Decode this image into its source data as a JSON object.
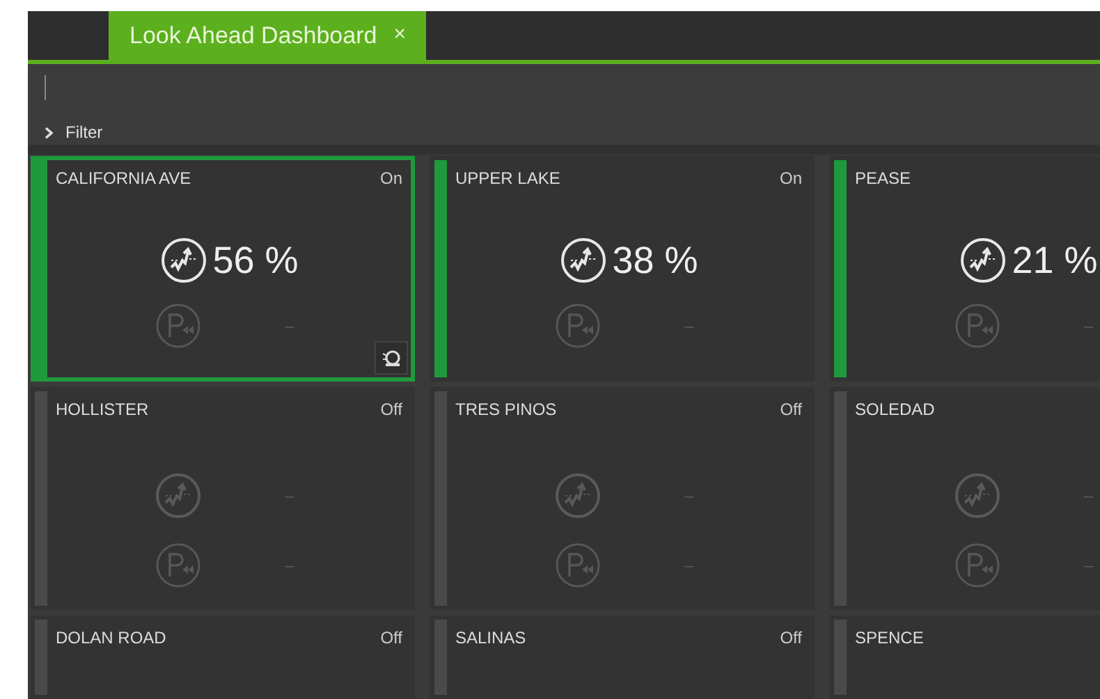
{
  "tabs": [
    {
      "label": "Look Ahead Dashboard",
      "close": "×",
      "selected": true
    }
  ],
  "filter": {
    "label": "Filter",
    "expanded": false
  },
  "cards": [
    {
      "name": "CALIFORNIA AVE",
      "status": "On",
      "on": true,
      "selected": true,
      "metrics": [
        {
          "kind": "trend",
          "value": "56 %",
          "active": true
        },
        {
          "kind": "parking",
          "value": "–",
          "active": false
        }
      ]
    },
    {
      "name": "UPPER LAKE",
      "status": "On",
      "on": true,
      "selected": false,
      "metrics": [
        {
          "kind": "trend",
          "value": "38 %",
          "active": true
        },
        {
          "kind": "parking",
          "value": "–",
          "active": false
        }
      ]
    },
    {
      "name": "PEASE",
      "on": true,
      "selected": false,
      "metrics": [
        {
          "kind": "trend",
          "value": "21 %",
          "active": true
        },
        {
          "kind": "parking",
          "value": "–",
          "active": false
        }
      ]
    },
    {
      "name": "HOLLISTER",
      "status": "Off",
      "on": false,
      "selected": false,
      "metrics": [
        {
          "kind": "trend",
          "value": "–",
          "active": false
        },
        {
          "kind": "parking",
          "value": "–",
          "active": false
        }
      ]
    },
    {
      "name": "TRES PINOS",
      "status": "Off",
      "on": false,
      "selected": false,
      "metrics": [
        {
          "kind": "trend",
          "value": "–",
          "active": false
        },
        {
          "kind": "parking",
          "value": "–",
          "active": false
        }
      ]
    },
    {
      "name": "SOLEDAD",
      "on": false,
      "selected": false,
      "metrics": [
        {
          "kind": "trend",
          "value": "–",
          "active": false
        },
        {
          "kind": "parking",
          "value": "–",
          "active": false
        }
      ]
    },
    {
      "name": "DOLAN ROAD",
      "status": "Off",
      "on": false,
      "selected": false
    },
    {
      "name": "SALINAS",
      "status": "Off",
      "on": false,
      "selected": false
    },
    {
      "name": "SPENCE",
      "on": false,
      "selected": false
    }
  ]
}
